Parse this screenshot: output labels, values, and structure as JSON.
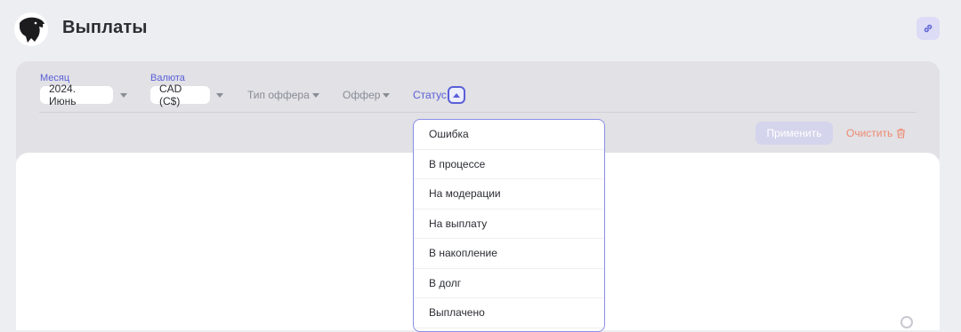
{
  "header": {
    "title": "Выплаты",
    "logo_icon": "eagle-logo-icon",
    "link_icon": "link-icon"
  },
  "filters": {
    "month": {
      "label": "Месяц",
      "value": "2024. Июнь"
    },
    "currency": {
      "label": "Валюта",
      "value": "CAD (C$)"
    },
    "offer_type": {
      "label": "Тип оффера"
    },
    "offer": {
      "label": "Оффер"
    },
    "status": {
      "label": "Статус",
      "expanded": true
    }
  },
  "actions": {
    "apply_label": "Применить",
    "clear_label": "Очистить",
    "clear_icon": "trash-icon"
  },
  "status_options": [
    "Ошибка",
    "В процессе",
    "На модерации",
    "На выплату",
    "В накопление",
    "В долг",
    "Выплачено"
  ],
  "colors": {
    "accent": "#5b5fd6",
    "clear": "#f08a70",
    "apply_disabled": "#d4d4ec"
  }
}
